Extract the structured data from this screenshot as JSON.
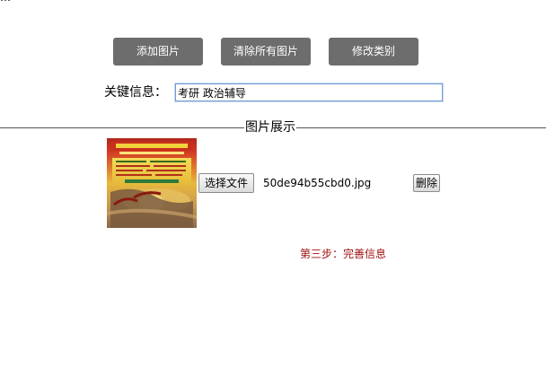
{
  "top_clipped_text": "…",
  "toolbar": {
    "add_label": "添加图片",
    "clear_label": "清除所有图片",
    "modify_label": "修改类别"
  },
  "keyword": {
    "label": "关键信息：",
    "value": "考研 政治辅导"
  },
  "gallery": {
    "title": "图片展示",
    "items": [
      {
        "choose_file_label": "选择文件",
        "file_name": "50de94b55cbd0.jpg",
        "delete_label": "删除"
      }
    ]
  },
  "step": {
    "label": "第三步：完善信息",
    "color": "#a01010"
  },
  "colors": {
    "button_bg": "#6d6d6d",
    "button_text": "#ffffff",
    "input_border": "#6f9bd4"
  }
}
